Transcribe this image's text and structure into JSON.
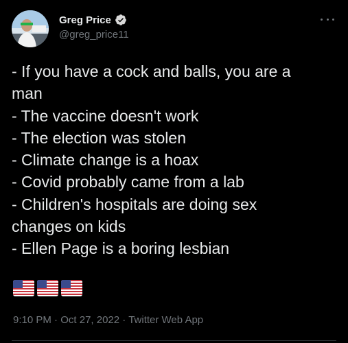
{
  "author": {
    "display_name": "Greg Price",
    "handle": "@greg_price11",
    "verified": true,
    "verified_color": "#d9d9d9"
  },
  "tweet": {
    "lines": [
      "- If you have a cock and balls, you are a",
      "man",
      "- The vaccine doesn't work",
      "- The election was stolen",
      "- Climate change is a hoax",
      "- Covid probably came from a lab",
      "- Children's hospitals are doing sex",
      "changes on kids",
      "- Ellen Page is a boring lesbian"
    ],
    "emoji": [
      "us-flag",
      "us-flag",
      "us-flag"
    ]
  },
  "meta": {
    "time": "9:10 PM",
    "separator": "·",
    "date": "Oct 27, 2022",
    "source": "Twitter Web App"
  },
  "colors": {
    "background": "#000000",
    "text": "#e7e9ea",
    "secondary_text": "#71767b"
  },
  "icons": {
    "more": "more-horizontal-icon",
    "verified": "verified-badge-icon"
  }
}
